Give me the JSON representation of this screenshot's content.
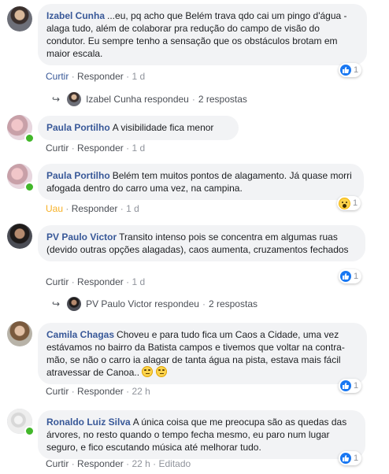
{
  "comments": [
    {
      "author": "Izabel Cunha",
      "text": "...eu, pq acho que Belém trava qdo cai um pingo d'água - alaga tudo, além de colaborar pra redução do campo de visão do condutor. Eu sempre tenho a sensação que os obstáculos brotam em maior escala.",
      "like": "Curtir",
      "reply": "Responder",
      "time": "1 d",
      "reaction_count": "1",
      "replies": {
        "author": "Izabel Cunha",
        "verb": "respondeu",
        "count": "2 respostas"
      }
    },
    {
      "author": "Paula Portilho",
      "text": "A visibilidade fica menor",
      "like": "Curtir",
      "reply": "Responder",
      "time": "1 d"
    },
    {
      "author": "Paula Portilho",
      "text": "Belém tem muitos pontos de alagamento. Já quase morri afogada dentro do carro uma vez, na campina.",
      "like": "Uau",
      "reply": "Responder",
      "time": "1 d",
      "reaction_count": "1"
    },
    {
      "author": "PV Paulo Victor",
      "text": "Transito intenso pois se concentra em algumas ruas (devido outras opções alagadas), caos aumenta, cruzamentos fechados",
      "like": "Curtir",
      "reply": "Responder",
      "time": "1 d",
      "reaction_count": "1",
      "replies": {
        "author": "PV Paulo Victor",
        "verb": "respondeu",
        "count": "2 respostas"
      }
    },
    {
      "author": "Camila Chagas",
      "text": "Choveu e para tudo fica um Caos a Cidade, uma vez estávamos no bairro da Batista campos e tivemos que voltar na contra-mão, se não o carro ia alagar de tanta água na pista, estava mais fácil atravessar de Canoa..",
      "like": "Curtir",
      "reply": "Responder",
      "time": "22 h",
      "reaction_count": "1"
    },
    {
      "author": "Ronaldo Luiz Silva",
      "text": "A única coisa que me preocupa são as quedas das árvores, no resto quando o tempo fecha mesmo, eu paro num lugar seguro, e fico escutando música até melhorar tudo.",
      "like": "Curtir",
      "reply": "Responder",
      "time": "22 h",
      "edited": "Editado",
      "reaction_count": "1"
    }
  ],
  "colors": {
    "link": "#385898",
    "bubble": "#f2f3f5",
    "meta": "#90949c",
    "like_blue": "#1877f2",
    "online": "#42b72a",
    "wow": "#f7b125"
  }
}
